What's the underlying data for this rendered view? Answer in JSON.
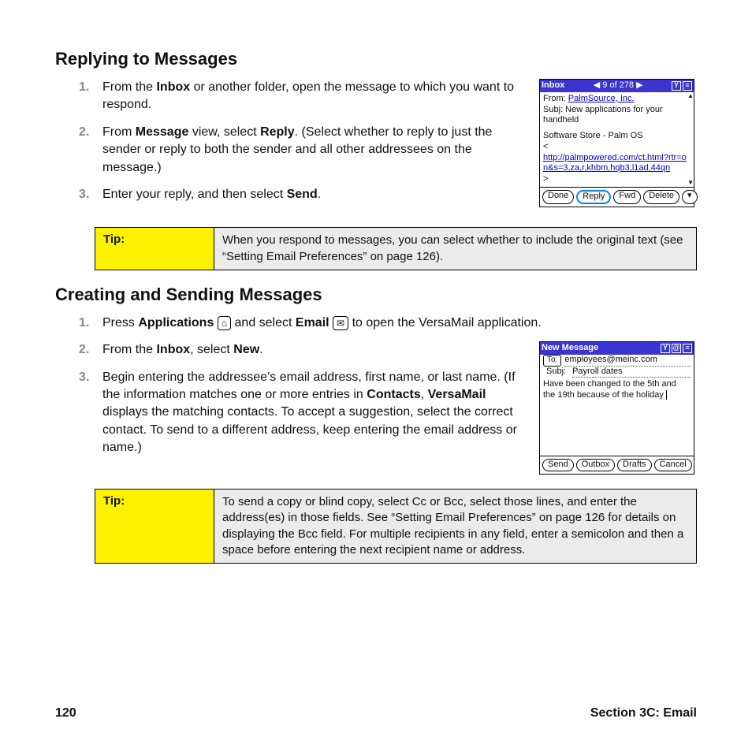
{
  "section1": {
    "heading": "Replying to Messages",
    "steps": [
      {
        "pre": "From the ",
        "b1": "Inbox",
        "post": " or another folder, open the message to which you want to respond."
      },
      {
        "pre": "From ",
        "b1": "Message",
        "mid": " view, select ",
        "b2": "Reply",
        "post": ". (Select whether to reply to just the sender or reply to both the sender and all other addressees on the message.)"
      },
      {
        "pre": "Enter your reply, and then select ",
        "b1": "Send",
        "post": "."
      }
    ]
  },
  "tip1": {
    "label": "Tip:",
    "text": "When you respond to messages, you can select whether to include the original text (see “Setting Email Preferences” on page 126)."
  },
  "section2": {
    "heading": "Creating and Sending Messages",
    "step1": {
      "pre": "Press ",
      "b1": "Applications",
      "mid": " and select ",
      "b2": "Email",
      "post": " to open the VersaMail application."
    },
    "step2": {
      "pre": "From the ",
      "b1": "Inbox",
      "mid": ", select ",
      "b2": "New",
      "post": "."
    },
    "step3": {
      "pre": "Begin entering the addressee’s email address, first name, or last name. (If the information matches one or more entries in ",
      "b1": "Contacts",
      "mid": ", ",
      "b2": "VersaMail",
      "post": " displays the matching contacts. To accept a suggestion, select the correct contact. To send to a different address, keep entering the email address or name.)"
    }
  },
  "tip2": {
    "label": "Tip:",
    "text": "To send a copy or blind copy, select Cc or Bcc, select those lines, and enter the address(es) in those fields. See “Setting Email Preferences” on page 126 for details on displaying the Bcc field. For multiple recipients in any field, enter a semicolon and then a space before entering the next recipient name or address."
  },
  "palm1": {
    "title": "Inbox",
    "counter": "9 of 278",
    "from_label": "From:",
    "from": "PalmSource, Inc.",
    "subj_label": "Subj:",
    "subj": "New applications for your handheld",
    "body1": "Software Store - Palm OS",
    "lt": "<",
    "link": "http://palmpowered.com/ct.html?rtr=on&s=3,za,r,khbm,hqb3,l1ad,44qn",
    "gt": ">",
    "btn_done": "Done",
    "btn_reply": "Reply",
    "btn_fwd": "Fwd",
    "btn_delete": "Delete"
  },
  "palm2": {
    "title": "New Message",
    "to_label": "To:",
    "to": "employees@meinc.com",
    "subj_label": "Subj:",
    "subj": "Payroll dates",
    "body": "Have been changed to the 5th and the 19th because of the holiday",
    "btn_send": "Send",
    "btn_outbox": "Outbox",
    "btn_drafts": "Drafts",
    "btn_cancel": "Cancel"
  },
  "footer": {
    "page": "120",
    "section": "Section 3C: Email"
  },
  "icons": {
    "house": "⌂",
    "mail": "✉",
    "arrow_l": "◀",
    "arrow_r": "▶",
    "signal": "▯",
    "menu": "☰",
    "clip": "@"
  }
}
